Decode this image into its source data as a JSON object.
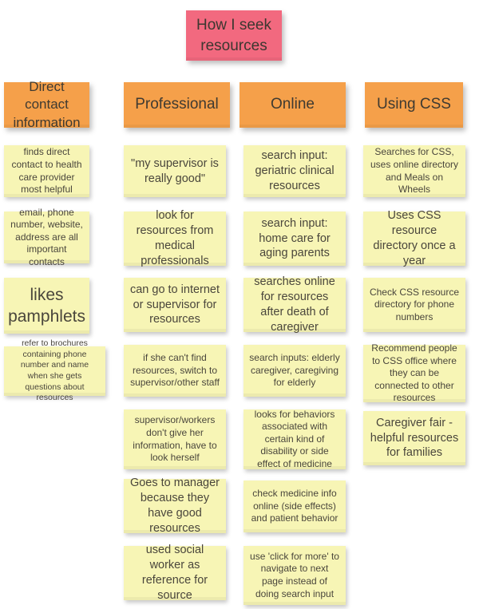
{
  "board": {
    "title_note": {
      "text": "How I seek resources",
      "color": "#f2697f"
    },
    "header_color": "#f5a04a",
    "note_color": "#f7f5b5",
    "columns": [
      {
        "header": "Direct contact information",
        "notes": [
          {
            "text": "finds direct contact to health care provider most helpful",
            "size": "sm"
          },
          {
            "text": "email, phone number, website, address are all important contacts",
            "size": "sm"
          },
          {
            "text": "likes pamphlets",
            "size": "lg"
          },
          {
            "text": "refer to brochures containing phone number and name when she gets questions about resources",
            "size": "xs"
          }
        ]
      },
      {
        "header": "Professional",
        "notes": [
          {
            "text": "\"my supervisor is really good\"",
            "size": "md"
          },
          {
            "text": "look for resources from medical professionals",
            "size": "md"
          },
          {
            "text": "can go to internet or supervisor for resources",
            "size": "md"
          },
          {
            "text": "if she can't find resources, switch to supervisor/other staff",
            "size": "sm"
          },
          {
            "text": "supervisor/workers don't give her information, have to look herself",
            "size": "sm"
          },
          {
            "text": "Goes to manager because they have good resources",
            "size": "md"
          },
          {
            "text": "used social worker as reference for source",
            "size": "md"
          }
        ]
      },
      {
        "header": "Online",
        "notes": [
          {
            "text": "search input: geriatric clinical resources",
            "size": "md"
          },
          {
            "text": "search input: home care for aging parents",
            "size": "md"
          },
          {
            "text": "searches online for resources after death of caregiver",
            "size": "md"
          },
          {
            "text": "search inputs: elderly caregiver, caregiving for elderly",
            "size": "sm"
          },
          {
            "text": "looks for behaviors associated with certain kind of disability or side effect of medicine",
            "size": "sm"
          },
          {
            "text": "check medicine info online (side effects) and patient behavior",
            "size": "sm"
          },
          {
            "text": "use 'click for more' to navigate to next page instead of doing search input",
            "size": "sm"
          }
        ]
      },
      {
        "header": "Using CSS",
        "notes": [
          {
            "text": "Searches for CSS, uses online directory and Meals on Wheels",
            "size": "sm"
          },
          {
            "text": "Uses CSS resource directory once a year",
            "size": "md"
          },
          {
            "text": "Check CSS resource directory for phone numbers",
            "size": "sm"
          },
          {
            "text": "Recommend people to CSS office where they can be connected to other resources",
            "size": "sm"
          },
          {
            "text": "Caregiver fair - helpful resources for families",
            "size": "md"
          }
        ]
      }
    ]
  }
}
